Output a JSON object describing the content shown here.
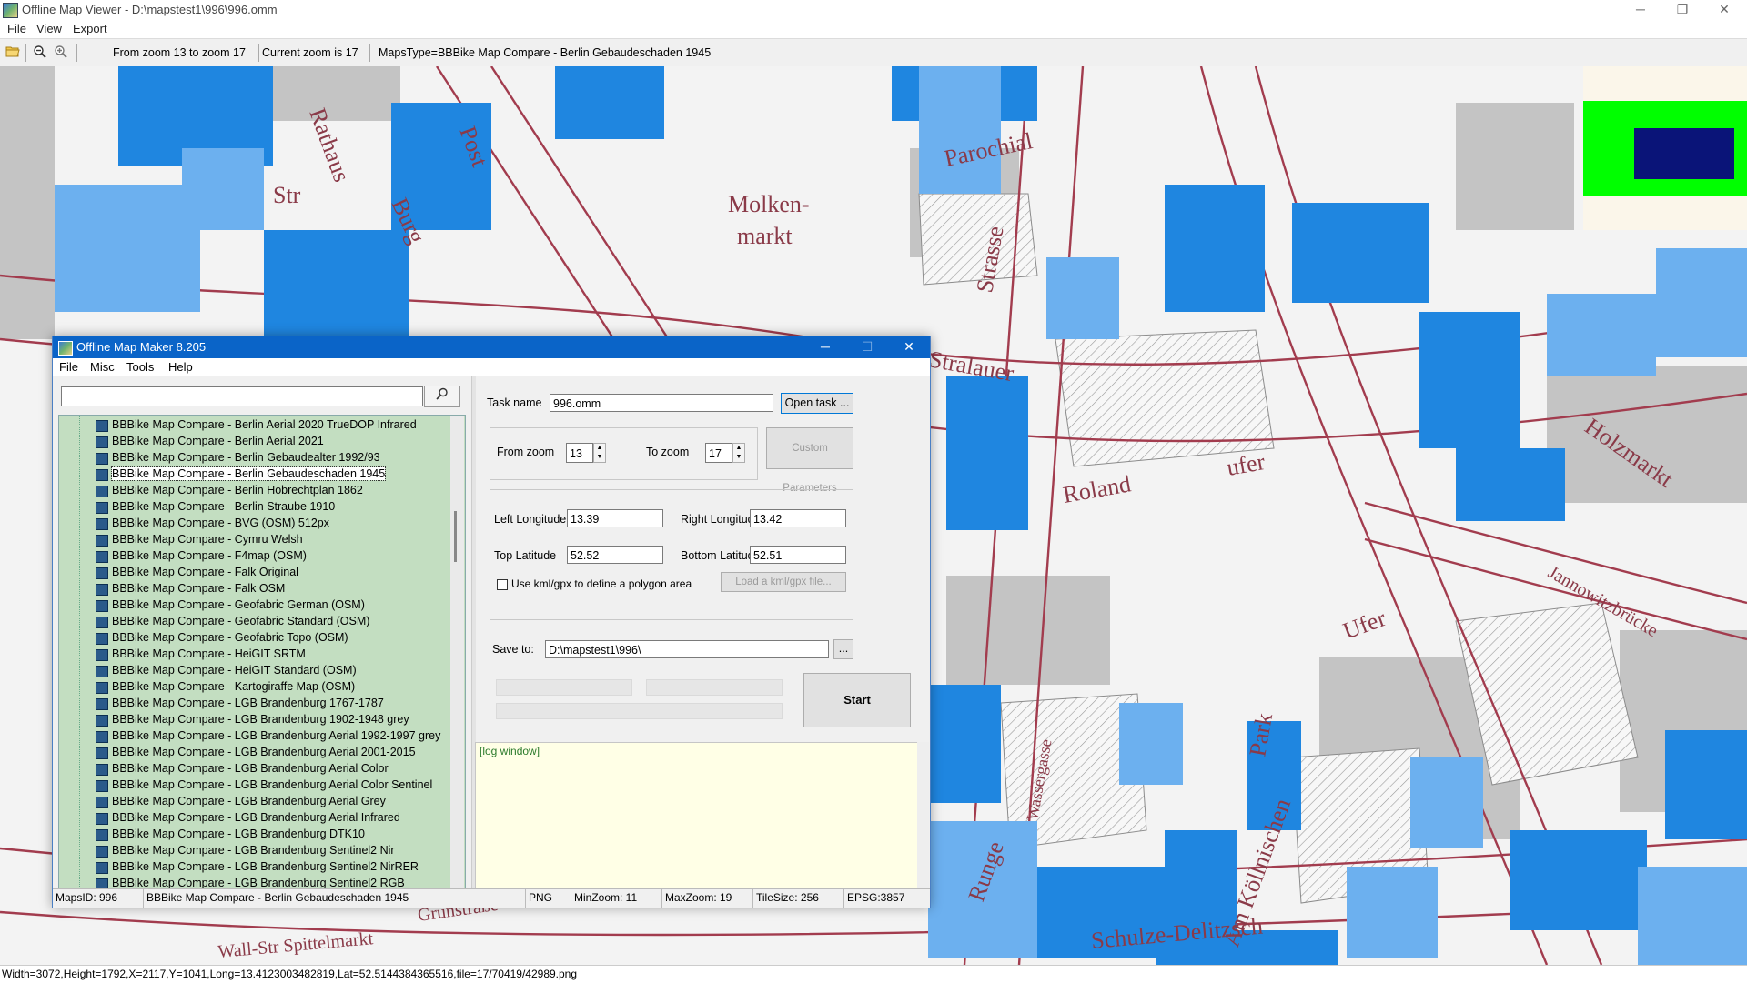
{
  "window": {
    "title": "Offline Map Viewer - D:\\mapstest1\\996\\996.omm",
    "minimize": "─",
    "restore": "❐",
    "close": "✕"
  },
  "menu": [
    "File",
    "View",
    "Export"
  ],
  "toolbar": {
    "icons": [
      "open-folder-icon",
      "zoom-out-icon",
      "zoom-in-icon"
    ],
    "zoom_range": "From zoom 13 to zoom 17",
    "current_zoom": "Current zoom is 17",
    "maps_type": "MapsType=BBBike Map Compare - Berlin Gebaudeschaden 1945"
  },
  "map": {
    "labels": [
      {
        "text": "Rathaus"
      },
      {
        "text": "Post"
      },
      {
        "text": "Burg"
      },
      {
        "text": "Parochial"
      },
      {
        "text": "Molken-"
      },
      {
        "text": "markt"
      },
      {
        "text": "Str"
      },
      {
        "text": "Strasse"
      },
      {
        "text": "Stralauer"
      },
      {
        "text": "Roland"
      },
      {
        "text": "ufer"
      },
      {
        "text": "Jannowitzbrücke"
      },
      {
        "text": "Holzmarkt"
      },
      {
        "text": "Ufer"
      },
      {
        "text": "Park"
      },
      {
        "text": "Runge"
      },
      {
        "text": "Wassergasse"
      },
      {
        "text": "Am Köllnischen"
      },
      {
        "text": "Schulze-Delitzsch"
      },
      {
        "text": "Wall-Str Spittelmarkt"
      },
      {
        "text": "Grünstraße"
      }
    ],
    "colors": {
      "building": "#1f86e0",
      "building_light": "#6cb0ef",
      "street": "#a23c4e",
      "block": "#bdbdbd"
    }
  },
  "minimap": {
    "bg": "#fbf6ea",
    "area": "#00ff00",
    "view": "#0a1478"
  },
  "statusbar": "Width=3072,Height=1792,X=2117,Y=1041,Long=13.4123003482819,Lat=52.5144384365516,file=17/70419/42989.png",
  "dialog": {
    "title": "Offline Map Maker 8.205",
    "menu": [
      "File",
      "Misc",
      "Tools",
      "Help"
    ],
    "search_value": "",
    "search_icon": "search-icon",
    "tree": [
      "BBBike Map Compare - Berlin Aerial 2020 TrueDOP Infrared",
      "BBBike Map Compare - Berlin Aerial 2021",
      "BBBike Map Compare - Berlin Gebaudealter 1992/93",
      "BBBike Map Compare - Berlin Gebaudeschaden 1945",
      "BBBike Map Compare - Berlin Hobrechtplan 1862",
      "BBBike Map Compare - Berlin Straube 1910",
      "BBBike Map Compare - BVG (OSM) 512px",
      "BBBike Map Compare - Cymru Welsh",
      "BBBike Map Compare - F4map (OSM)",
      "BBBike Map Compare - Falk Original",
      "BBBike Map Compare - Falk OSM",
      "BBBike Map Compare - Geofabric German (OSM)",
      "BBBike Map Compare - Geofabric Standard (OSM)",
      "BBBike Map Compare - Geofabric Topo (OSM)",
      "BBBike Map Compare - HeiGIT SRTM",
      "BBBike Map Compare - HeiGIT Standard (OSM)",
      "BBBike Map Compare - Kartogiraffe Map (OSM)",
      "BBBike Map Compare - LGB Brandenburg 1767-1787",
      "BBBike Map Compare - LGB Brandenburg 1902-1948 grey",
      "BBBike Map Compare - LGB Brandenburg Aerial 1992-1997 grey",
      "BBBike Map Compare - LGB Brandenburg Aerial 2001-2015",
      "BBBike Map Compare - LGB Brandenburg Aerial Color",
      "BBBike Map Compare - LGB Brandenburg Aerial Color Sentinel",
      "BBBike Map Compare - LGB Brandenburg Aerial Grey",
      "BBBike Map Compare - LGB Brandenburg Aerial Infrared",
      "BBBike Map Compare - LGB Brandenburg DTK10",
      "BBBike Map Compare - LGB Brandenburg Sentinel2 Nir",
      "BBBike Map Compare - LGB Brandenburg Sentinel2 NirRER",
      "BBBike Map Compare - LGB Brandenburg Sentinel2 RGB"
    ],
    "selected_index": 3,
    "task_name_label": "Task name",
    "task_name": "996.omm",
    "open_task": "Open task ...",
    "from_zoom_label": "From zoom",
    "from_zoom": "13",
    "to_zoom_label": "To zoom",
    "to_zoom": "17",
    "custom_params": "Custom Parameters",
    "left_lon_label": "Left Longitude",
    "left_lon": "13.39",
    "right_lon_label": "Right Longitude",
    "right_lon": "13.42",
    "top_lat_label": "Top Latitude",
    "top_lat": "52.52",
    "bottom_lat_label": "Bottom Latitude",
    "bottom_lat": "52.51",
    "kml_checkbox": "Use kml/gpx to define a polygon area",
    "kml_checked": false,
    "load_kml": "Load a kml/gpx file...",
    "save_to_label": "Save to:",
    "save_to": "D:\\mapstest1\\996\\",
    "browse": "...",
    "start": "Start",
    "log": "[log window]",
    "status": {
      "maps_id": "MapsID: 996",
      "maps_name": "BBBike Map Compare - Berlin Gebaudeschaden 1945",
      "format": "PNG",
      "min_zoom": "MinZoom: 11",
      "max_zoom": "MaxZoom: 19",
      "tile_size": "TileSize: 256",
      "epsg": "EPSG:3857"
    }
  }
}
